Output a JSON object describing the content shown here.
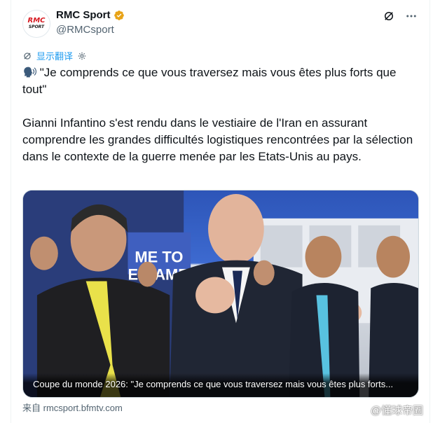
{
  "account": {
    "display_name": "RMC Sport",
    "handle": "@RMCsport",
    "avatar_text": "RMC",
    "avatar_subtext": "SPORT",
    "verified_color": "#e8a317"
  },
  "header_icons": [
    "grok-icon",
    "more-options-icon"
  ],
  "translate": {
    "label": "显示翻译"
  },
  "tweet": {
    "quote_line": "\"Je comprends ce que vous traversez mais vous êtes plus forts que tout\"",
    "body": "Gianni Infantino s'est rendu dans le vestiaire de l'Iran en assurant comprendre les grandes difficultés logistiques rencontrées par la sélection dans le contexte de la guerre menée par les Etats-Unis au pays."
  },
  "media": {
    "caption": "Coupe du monde 2026: \"Je comprends ce que vous traversez mais vous êtes plus forts...",
    "background_banner_text": "ME TO\nE GAME",
    "alt": "Infantino in Iran locker room"
  },
  "source": {
    "label": "来自 rmcsport.bfmtv.com"
  },
  "watermark": {
    "label": "@懂球帝圈"
  },
  "colors": {
    "link": "#1d9bf0",
    "secondary_text": "#536471",
    "brand_red": "#d71920"
  }
}
